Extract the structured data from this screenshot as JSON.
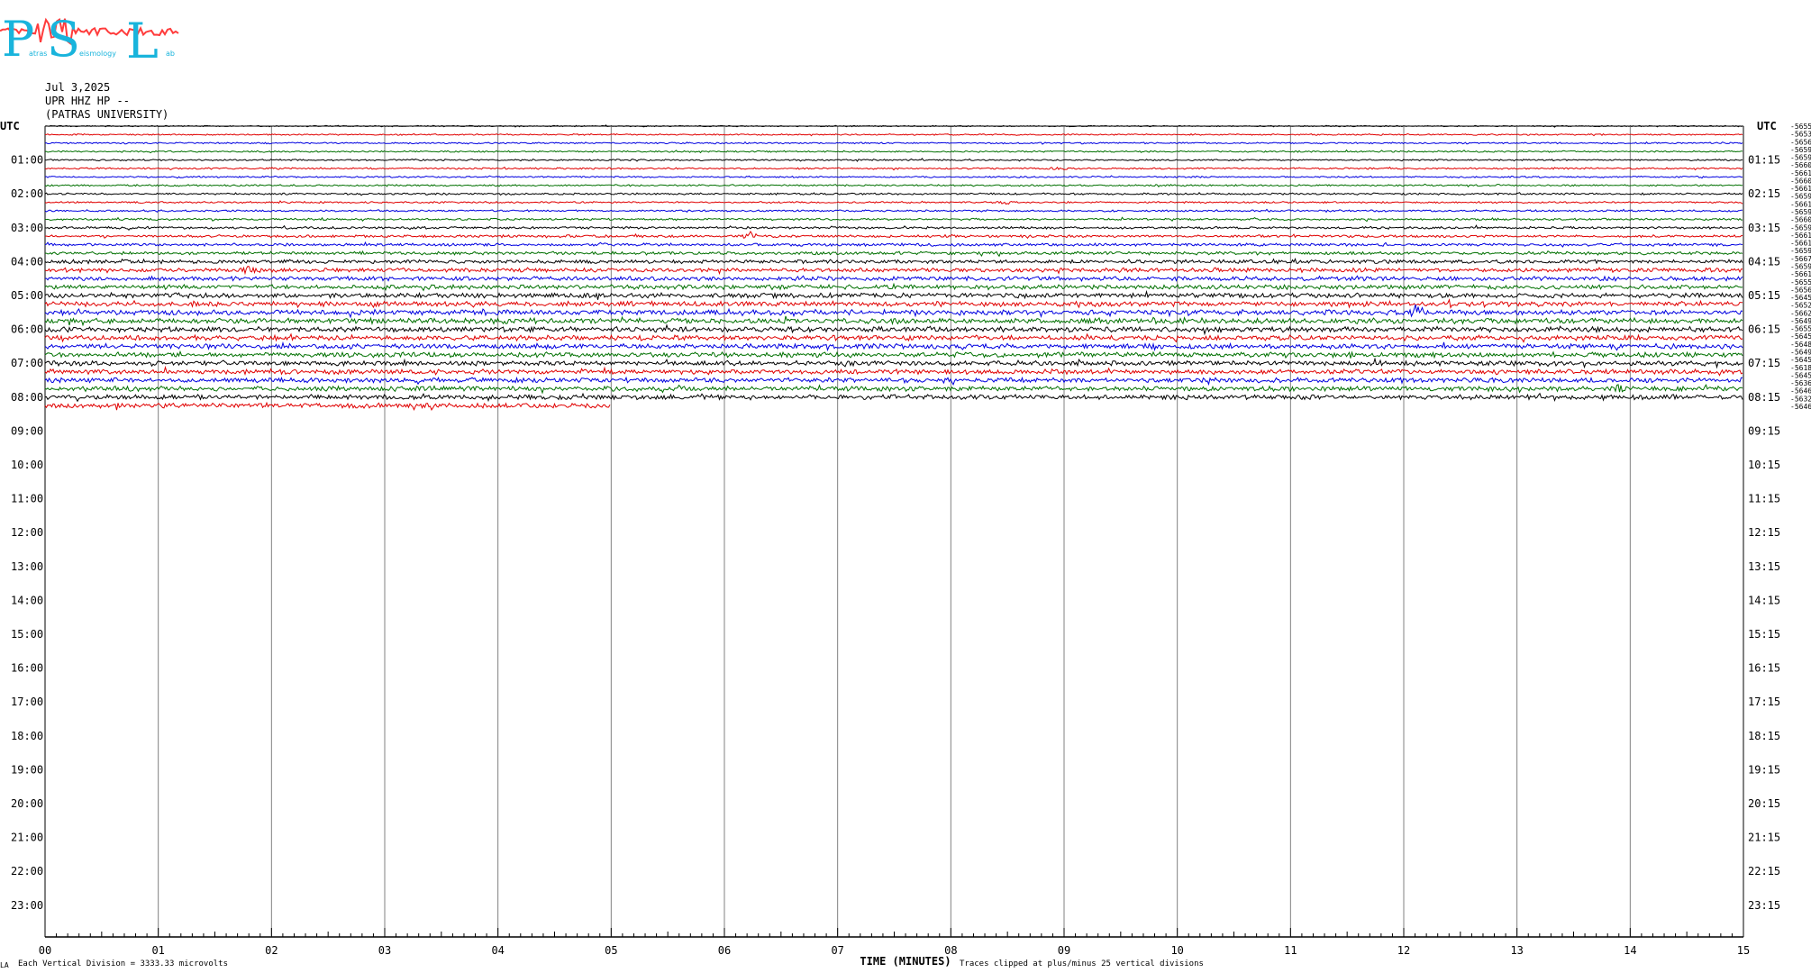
{
  "logo": {
    "letters": [
      "P",
      "S",
      "L"
    ],
    "words": [
      "atras",
      "eismology",
      "ab"
    ]
  },
  "header": {
    "date": "Jul 3,2025",
    "station": "UPR HHZ HP --",
    "institution": "(PATRAS UNIVERSITY)"
  },
  "footer": {
    "left_mark": "LA",
    "scale_note": "Each Vertical Division = 3333.33 microvolts",
    "clip_note": "Traces clipped at plus/minus 25 vertical divisions"
  },
  "colors": {
    "trace_cycle": [
      "#000000",
      "#e00000",
      "#0000e0",
      "#007000"
    ],
    "grid": "#808080",
    "logo_red": "#ff3c3c",
    "logo_cyan": "#19b4dc"
  },
  "chart_data": {
    "type": "line",
    "title": "",
    "xlabel": "TIME (MINUTES)",
    "ylabel": "UTC",
    "y_right_label": "UTC",
    "x_range": [
      0,
      15
    ],
    "x_ticks": [
      "00",
      "01",
      "02",
      "03",
      "04",
      "05",
      "06",
      "07",
      "08",
      "09",
      "10",
      "11",
      "12",
      "13",
      "14",
      "15"
    ],
    "left_hour_labels": [
      "01:00",
      "02:00",
      "03:00",
      "04:00",
      "05:00",
      "06:00",
      "07:00",
      "08:00",
      "09:00",
      "10:00",
      "11:00",
      "12:00",
      "13:00",
      "14:00",
      "15:00",
      "16:00",
      "17:00",
      "18:00",
      "19:00",
      "20:00",
      "21:00",
      "22:00",
      "23:00"
    ],
    "right_hour_labels": [
      "01:15",
      "02:15",
      "03:15",
      "04:15",
      "05:15",
      "06:15",
      "07:15",
      "08:15",
      "09:15",
      "10:15",
      "11:15",
      "12:15",
      "13:15",
      "14:15",
      "15:15",
      "16:15",
      "17:15",
      "18:15",
      "19:15",
      "20:15",
      "21:15",
      "22:15",
      "23:15"
    ],
    "trace_count": 34,
    "last_trace_minutes": 5,
    "trace_offsets": [
      "-5655",
      "-5653",
      "-5656",
      "-5659",
      "-5659",
      "-5660",
      "-5661",
      "-5660",
      "-5661",
      "-5659",
      "-5661",
      "-5659",
      "-5660",
      "-5659",
      "-5661",
      "-5661",
      "-5659",
      "-5667",
      "-5659",
      "-5661",
      "-5655",
      "-5656",
      "-5645",
      "-5652",
      "-5662",
      "-5649",
      "-5655",
      "-5645",
      "-5648",
      "-5649",
      "-5645",
      "-5618",
      "-5645",
      "-5636",
      "-5646",
      "-5632",
      "-5646"
    ],
    "trace_amplitudes": [
      0.8,
      0.9,
      1,
      1,
      1,
      1.1,
      1,
      1.1,
      1.2,
      1.1,
      1.2,
      1.3,
      1.5,
      1.6,
      1.8,
      2,
      2.3,
      2.5,
      2.6,
      2.8,
      3,
      3.1,
      3.2,
      3.3,
      3.3,
      3.2,
      3.1,
      3.1,
      3,
      3,
      3,
      3,
      3,
      3.1
    ],
    "events": [
      {
        "trace": 5,
        "minute": 8.95,
        "amp": 3
      },
      {
        "trace": 9,
        "minute": 8.5,
        "amp": 3
      },
      {
        "trace": 13,
        "minute": 6.25,
        "amp": 7
      },
      {
        "trace": 17,
        "minute": 1.8,
        "amp": 5
      },
      {
        "trace": 20,
        "minute": 1.2,
        "amp": 4
      },
      {
        "trace": 21,
        "minute": 2.9,
        "amp": 4
      },
      {
        "trace": 22,
        "minute": 12.1,
        "amp": 10
      },
      {
        "trace": 26,
        "minute": 8.1,
        "amp": 4
      },
      {
        "trace": 31,
        "minute": 13.9,
        "amp": 4
      },
      {
        "trace": 33,
        "minute": 10.4,
        "amp": 5
      }
    ]
  }
}
